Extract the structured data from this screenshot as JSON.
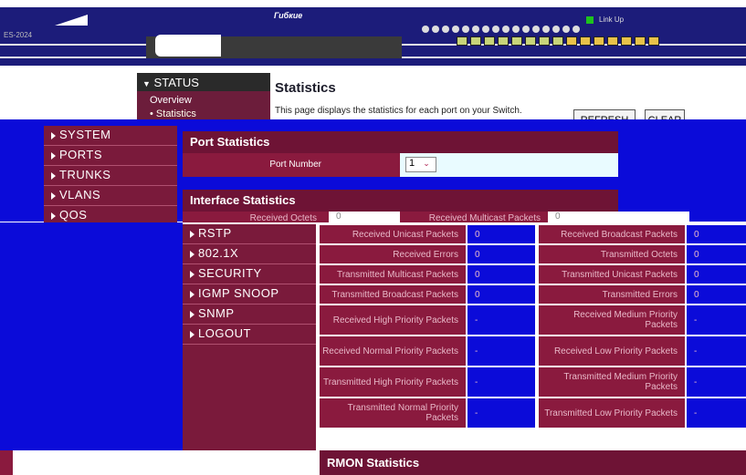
{
  "header": {
    "brand_text": "Гибкие",
    "link_label": "Link Up",
    "left_label": "ES-2024"
  },
  "nav": {
    "section_title": "STATUS",
    "sub_items": [
      "Overview",
      "Statistics"
    ],
    "top_items": [
      "SYSTEM",
      "PORTS",
      "TRUNKS",
      "VLANS",
      "QOS"
    ],
    "lower_items": [
      "RSTP",
      "802.1X",
      "SECURITY",
      "IGMP SNOOP",
      "SNMP",
      "LOGOUT"
    ]
  },
  "page": {
    "title": "Statistics",
    "description": "This page displays the statistics for each port on your Switch.",
    "refresh_label": "REFRESH",
    "clear_label": "CLEAR"
  },
  "port_stats": {
    "header": "Port Statistics",
    "port_number_label": "Port Number",
    "port_number_value": "1"
  },
  "interface_stats": {
    "header": "Interface Statistics",
    "received_octets_label": "Received Octets",
    "received_octets_value": "0",
    "received_multicast_label": "Received Multicast Packets",
    "received_multicast_value": "0",
    "rows": [
      {
        "l": "Received Unicast Packets",
        "lv": "0",
        "r": "Received Broadcast Packets",
        "rv": "0"
      },
      {
        "l": "Received Errors",
        "lv": "0",
        "r": "Transmitted Octets",
        "rv": "0"
      },
      {
        "l": "Transmitted Multicast Packets",
        "lv": "0",
        "r": "Transmitted Unicast Packets",
        "rv": "0"
      },
      {
        "l": "Transmitted Broadcast Packets",
        "lv": "0",
        "r": "Transmitted Errors",
        "rv": "0"
      },
      {
        "l": "Received High Priority Packets",
        "lv": "-",
        "r": "Received Medium Priority Packets",
        "rv": "-"
      },
      {
        "l": "Received Normal Priority Packets",
        "lv": "-",
        "r": "Received Low Priority Packets",
        "rv": "-"
      },
      {
        "l": "Transmitted High Priority Packets",
        "lv": "-",
        "r": "Transmitted Medium Priority Packets",
        "rv": "-"
      },
      {
        "l": "Transmitted Normal Priority Packets",
        "lv": "-",
        "r": "Transmitted Low Priority Packets",
        "rv": "-"
      }
    ]
  },
  "rmon": {
    "header": "RMON Statistics"
  }
}
